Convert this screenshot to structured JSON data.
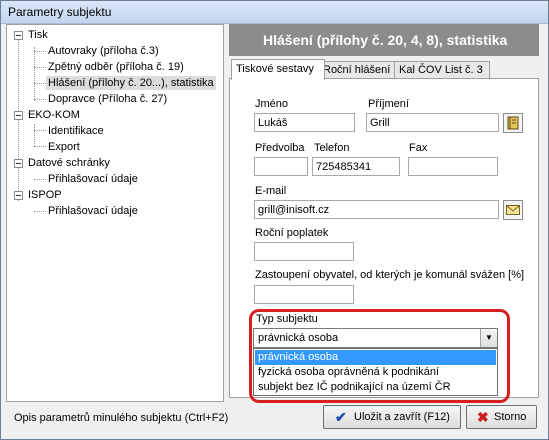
{
  "window": {
    "title": "Parametry subjektu"
  },
  "tree": {
    "tisk": "Tisk",
    "autovraky": "Autovraky (příloha č.3)",
    "zpetny": "Zpětný odběr (příloha č. 19)",
    "hlaseni": "Hlášení  (přílohy č. 20...), statistika",
    "dopravce": "Dopravce (Příloha č. 27)",
    "ekokom": "EKO-KOM",
    "identifikace": "Identifikace",
    "export": "Export",
    "datove": "Datové schránky",
    "prihl1": "Přihlašovací údaje",
    "ispop": "ISPOP",
    "prihl2": "Přihlašovací údaje"
  },
  "header": {
    "title": "Hlášení  (přílohy č. 20, 4, 8), statistika"
  },
  "tabs": [
    "Tiskové sestavy",
    "Roční hlášení",
    "Kal ČOV List č. 3"
  ],
  "form": {
    "jmeno_label": "Jméno",
    "jmeno_value": "Lukáš",
    "prijmeni_label": "Příjmení",
    "prijmeni_value": "Grill",
    "predvolba_label": "Předvolba",
    "predvolba_value": "",
    "telefon_label": "Telefon",
    "telefon_value": "725485341",
    "fax_label": "Fax",
    "fax_value": "",
    "email_label": "E-mail",
    "email_value": "grill@inisoft.cz",
    "rocni_label": "Roční poplatek",
    "rocni_value": "",
    "zastoupeni_label": "Zastoupení obyvatel, od kterých je komunál svážen [%]",
    "zastoupeni_value": "",
    "typ_label": "Typ subjektu",
    "typ_value": "právnická osoba",
    "typ_options": [
      "právnická osoba",
      "fyzická osoba oprávněná k podnikání",
      "subjekt bez IČ podnikající na území ČR"
    ]
  },
  "footer": {
    "hint": "Opis parametrů minulého subjektu (Ctrl+F2)",
    "save_label": "Uložit a zavřít (F12)",
    "cancel_label": "Storno"
  },
  "icons": [
    "address-book-icon",
    "envelope-icon",
    "dropdown-arrow-icon",
    "checkmark-icon",
    "x-icon"
  ],
  "colors": {
    "header_bg": "#8c8c8c",
    "highlight": "#d62020",
    "selection": "#3399ff"
  }
}
